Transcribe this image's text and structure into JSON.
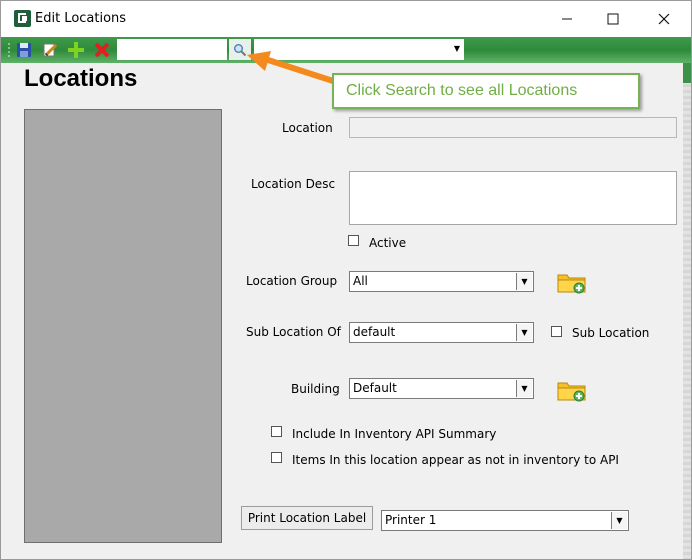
{
  "window": {
    "title": "Edit Locations"
  },
  "toolbar": {
    "search_value": "",
    "combo_value": ""
  },
  "main": {
    "page_title": "Locations"
  },
  "form": {
    "location_label": "Location",
    "location_value": "",
    "location_desc_label": "Location Desc",
    "location_desc_value": "",
    "active_label": "Active",
    "location_group_label": "Location Group",
    "location_group_value": "All",
    "sub_location_of_label": "Sub Location Of",
    "sub_location_of_value": "default",
    "sub_location_label": "Sub Location",
    "building_label": "Building",
    "building_value": "Default",
    "include_inventory_label": "Include In Inventory API Summary",
    "not_in_inventory_label": "Items In this location appear as not in inventory to API",
    "print_label_button": "Print Location Label",
    "printer_value": "Printer 1"
  },
  "callout": {
    "text": "Click Search to see all Locations"
  },
  "colors": {
    "toolbar_green": "#2f8a3c",
    "callout_border": "#77b255",
    "callout_text": "#70ad47",
    "arrow": "#f28a1e"
  }
}
